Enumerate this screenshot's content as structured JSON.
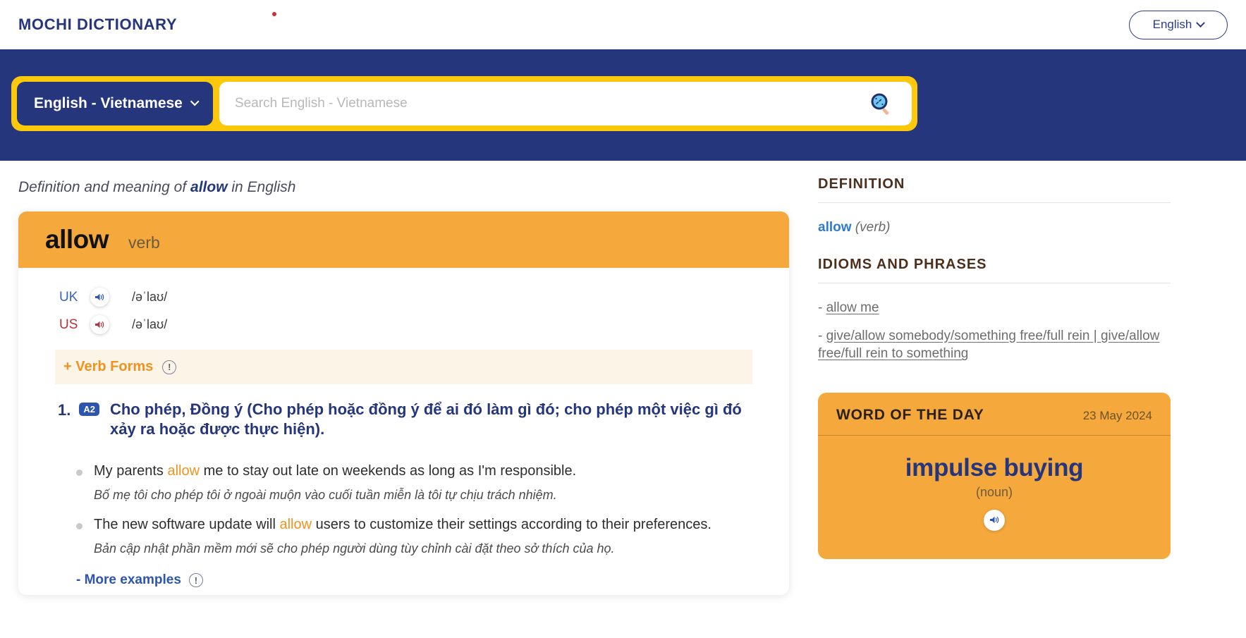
{
  "topbar": {
    "brand": "MOCHI DICTIONARY",
    "ui_language": "English"
  },
  "search": {
    "language_pair": "English - Vietnamese",
    "placeholder": "Search English - Vietnamese",
    "value": "",
    "search_icon": "magnifier-icon"
  },
  "breadcrumb": {
    "prefix": "Definition and meaning of",
    "word": "allow",
    "suffix": "in English"
  },
  "word_card": {
    "word": "allow",
    "part_of_speech": "verb",
    "pronunciations": [
      {
        "region": "UK",
        "ipa": "/əˈlaʊ/",
        "speaker_icon": "speaker-icon"
      },
      {
        "region": "US",
        "ipa": "/əˈlaʊ/",
        "speaker_icon": "speaker-icon"
      }
    ],
    "verb_forms_label": "+ Verb Forms",
    "verb_forms_icon": "info-exclamation-icon",
    "definitions": [
      {
        "number": "1.",
        "level": "A2",
        "text": "Cho phép, Đồng ý (Cho phép hoặc đồng ý để ai đó làm gì đó; cho phép một việc gì đó xảy ra hoặc được thực hiện).",
        "examples": [
          {
            "en_before": "My parents ",
            "en_highlight": "allow",
            "en_after": " me to stay out late on weekends as long as I'm responsible.",
            "vi": "Bố mẹ tôi cho phép tôi ở ngoài muộn vào cuối tuần miễn là tôi tự chịu trách nhiệm."
          },
          {
            "en_before": "The new software update will ",
            "en_highlight": "allow",
            "en_after": " users to customize their settings according to their preferences.",
            "vi": "Bản cập nhật phần mềm mới sẽ cho phép người dùng tùy chỉnh cài đặt theo sở thích của họ."
          }
        ]
      }
    ],
    "more_examples_label": "- More examples",
    "more_examples_icon": "info-exclamation-icon"
  },
  "sidebar": {
    "definition_section": {
      "heading": "DEFINITION",
      "word": "allow",
      "part_of_speech": "(verb)"
    },
    "idioms_section": {
      "heading": "IDIOMS AND PHRASES",
      "items": [
        {
          "dash": "-",
          "text": "allow me"
        },
        {
          "dash": "-",
          "text": "give/allow somebody/something free/full rein | give/allow free/full rein to something"
        }
      ]
    },
    "word_of_the_day": {
      "title": "WORD OF THE DAY",
      "date": "23 May 2024",
      "word": "impulse buying",
      "part_of_speech": "(noun)",
      "speaker_icon": "speaker-icon"
    }
  },
  "colors": {
    "navy": "#26367d",
    "yellow": "#fcc80c",
    "orange": "#f5a83c",
    "accent_orange": "#f0921f",
    "link_blue": "#2e7ad1",
    "brown": "#4c2f1c"
  }
}
